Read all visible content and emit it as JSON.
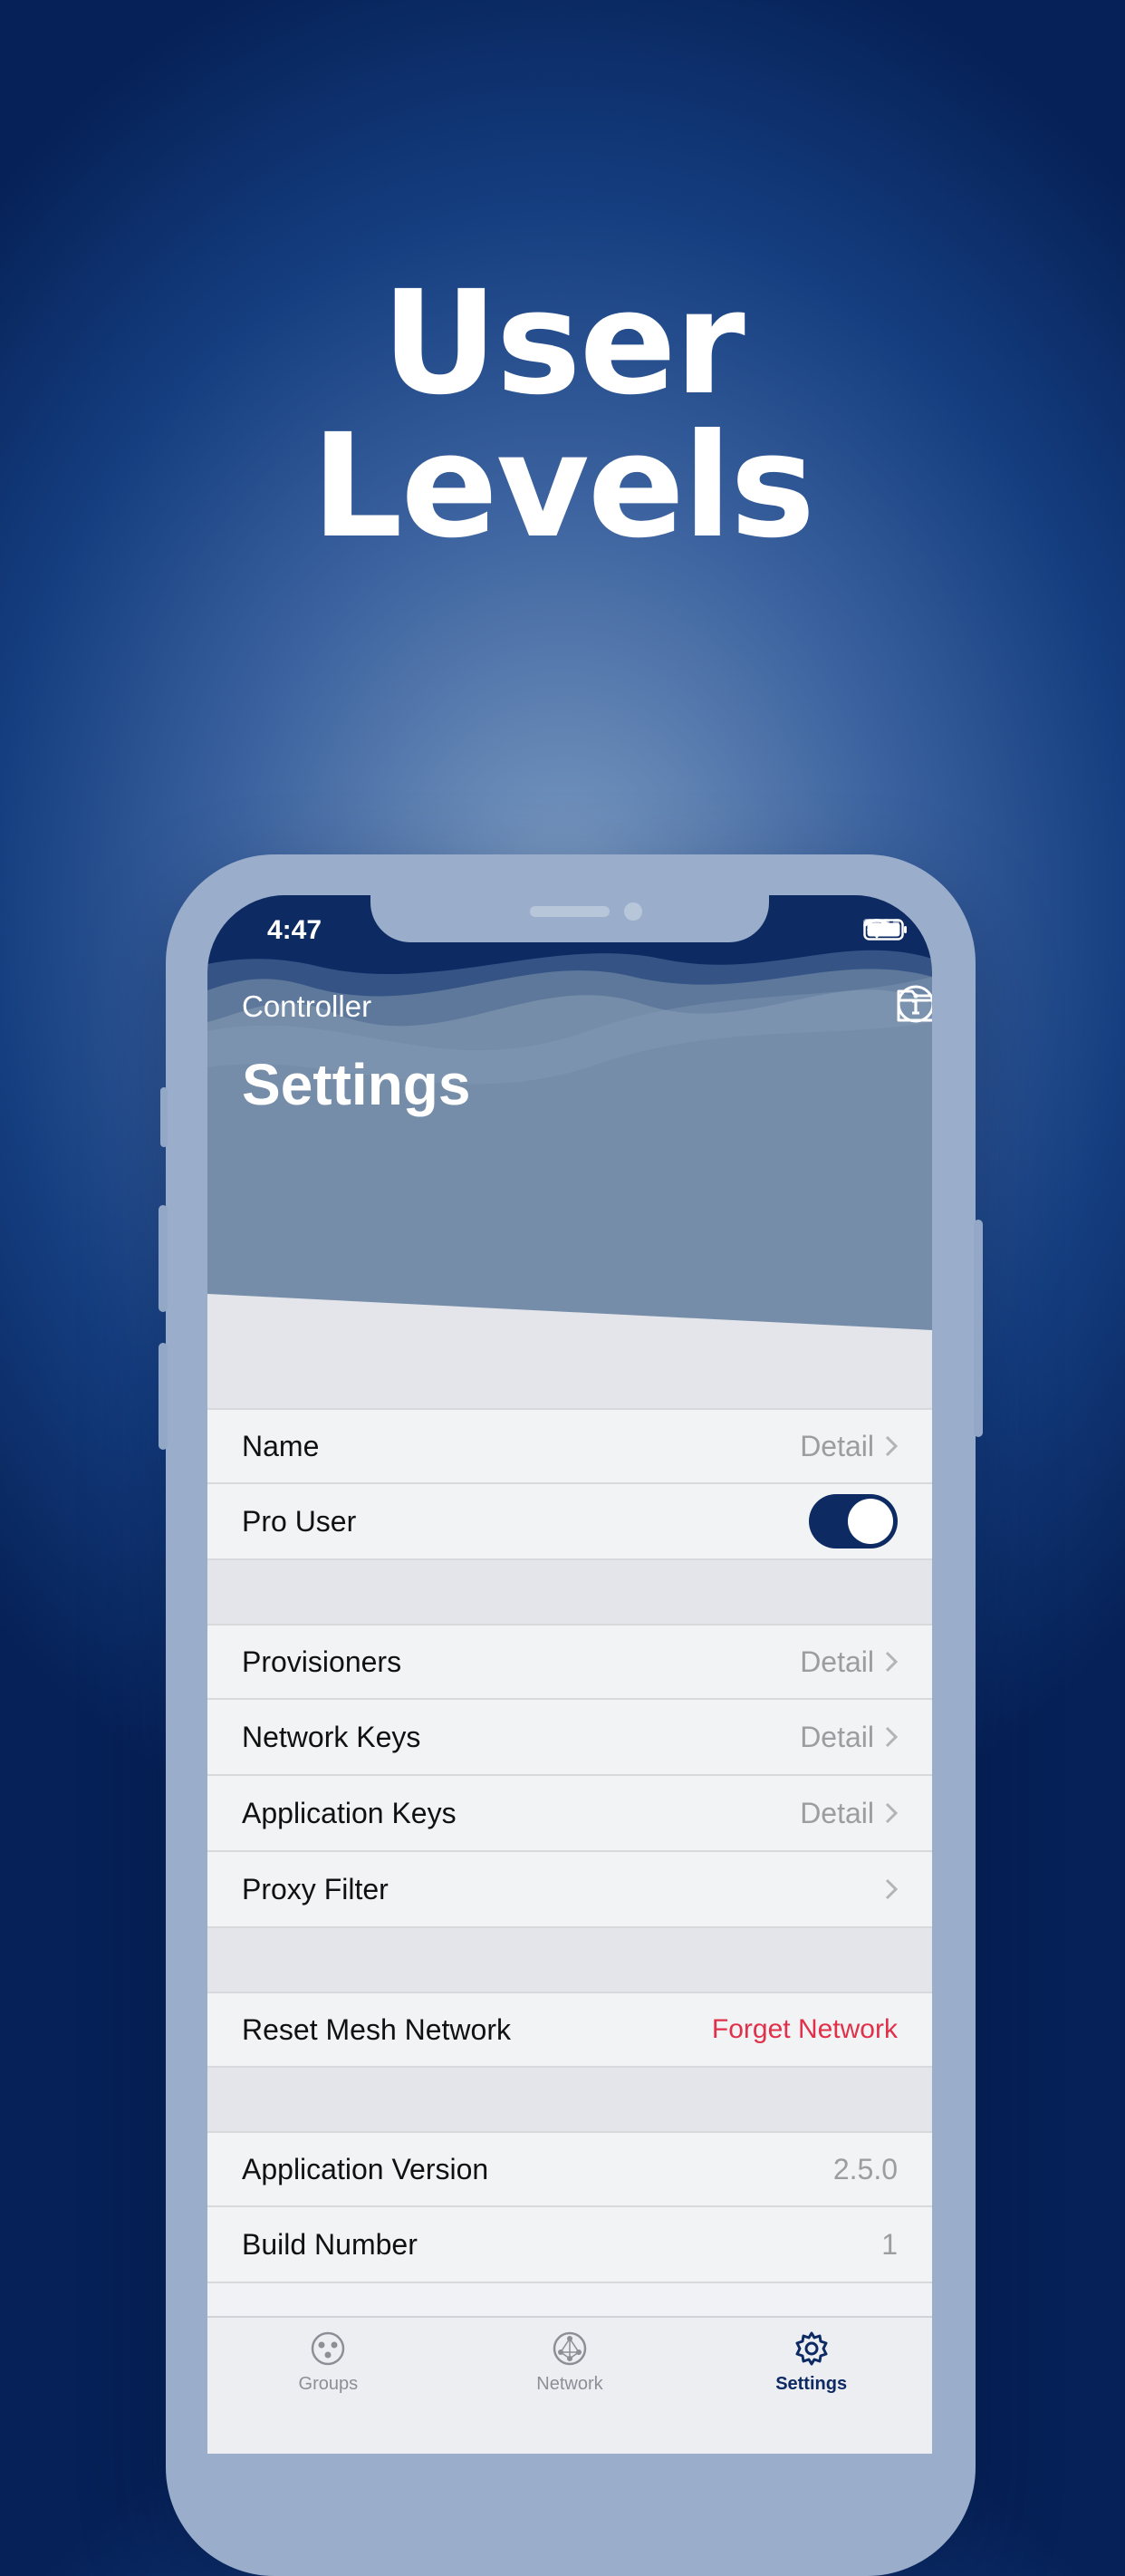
{
  "headline": {
    "line1": "User",
    "line2": "Levels"
  },
  "status": {
    "time": "4:47"
  },
  "nav": {
    "back_label": "Controller",
    "title": "Settings"
  },
  "sections": [
    {
      "rows": [
        {
          "label": "Name",
          "detail": "Detail",
          "accessory": "chevron"
        },
        {
          "label": "Pro User",
          "accessory": "toggle",
          "toggle_on": true
        }
      ]
    },
    {
      "rows": [
        {
          "label": "Provisioners",
          "detail": "Detail",
          "accessory": "chevron"
        },
        {
          "label": "Network Keys",
          "detail": "Detail",
          "accessory": "chevron"
        },
        {
          "label": "Application Keys",
          "detail": "Detail",
          "accessory": "chevron"
        },
        {
          "label": "Proxy Filter",
          "detail": "",
          "accessory": "chevron"
        }
      ]
    },
    {
      "rows": [
        {
          "label": "Reset Mesh Network",
          "action": "Forget Network"
        }
      ]
    },
    {
      "rows": [
        {
          "label": "Application Version",
          "value": "2.5.0"
        },
        {
          "label": "Build Number",
          "value": "1"
        }
      ]
    }
  ],
  "tabs": [
    {
      "label": "Groups",
      "icon": "groups-icon",
      "active": false
    },
    {
      "label": "Network",
      "icon": "network-icon",
      "active": false
    },
    {
      "label": "Settings",
      "icon": "gear-icon",
      "active": true
    }
  ],
  "colors": {
    "accent": "#0d2a63",
    "destructive": "#e0304a",
    "background_dark": "#062157"
  }
}
